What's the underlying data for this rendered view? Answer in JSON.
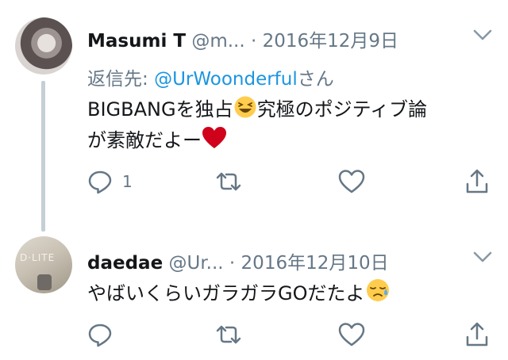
{
  "tweets": [
    {
      "name": "Masumi T",
      "handle": "@m...",
      "separator": "·",
      "date": "2016年12月9日",
      "reply_prefix": "返信先: ",
      "reply_handle": "@UrWoonderful",
      "reply_suffix": "さん",
      "text_line1_a": "BIGBANGを独占",
      "text_line1_b": "究極のポジティブ論",
      "text_line2": "が素敵だよー",
      "reply_count": "1",
      "emojis": [
        "laughing-emoji",
        "heart-emoji"
      ]
    },
    {
      "name": "daedae",
      "handle": "@Ur...",
      "separator": "·",
      "date": "2016年12月10日",
      "text_line1": "やばいくらいガラガラGOだたよ",
      "avatar_text": "D·LITE",
      "emojis": [
        "sad-sweat-emoji"
      ]
    }
  ],
  "icons": [
    "reply-icon",
    "retweet-icon",
    "like-icon",
    "share-icon",
    "chevron-down-icon"
  ],
  "colors": {
    "link": "#1b95e0",
    "muted": "#657786",
    "thread": "#c4cfd6",
    "heart": "#d0021b",
    "emoji": "#ffcc4d"
  }
}
